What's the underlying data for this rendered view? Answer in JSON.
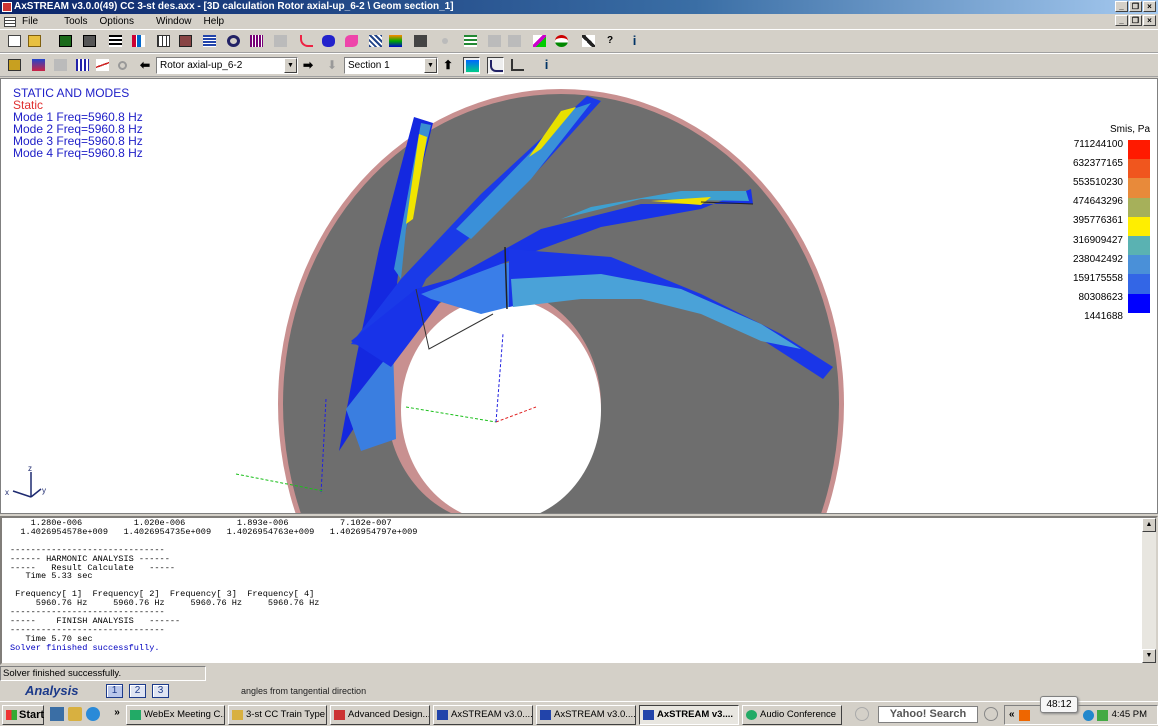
{
  "window": {
    "title": "AxSTREAM  v3.0.0(49)   CC 3-st des.axx - [3D calculation  Rotor axial-up_6-2 \\ Geom section_1]"
  },
  "menu": {
    "items": [
      "File",
      "Tools",
      "Options",
      "Window",
      "Help"
    ]
  },
  "toolbar2": {
    "rotor_select": "Rotor axial-up_6-2",
    "section_select": "Section 1"
  },
  "viewport": {
    "overlay_heading": "STATIC AND MODES",
    "static_label": "Static",
    "modes": [
      "Mode 1 Freq=5960.8 Hz",
      "Mode 2 Freq=5960.8 Hz",
      "Mode 3 Freq=5960.8 Hz",
      "Mode 4 Freq=5960.8 Hz"
    ],
    "axis_labels": {
      "x": "x",
      "y": "y",
      "z": "z"
    },
    "legend": {
      "title": "Smis, Pa",
      "values": [
        "711244100",
        "632377165",
        "553510230",
        "474643296",
        "395776361",
        "316909427",
        "238042492",
        "159175558",
        "80308623",
        "1441688"
      ],
      "colors": [
        "#ff1a00",
        "#f0561e",
        "#e88a3a",
        "#a6b05a",
        "#ffee00",
        "#5ab2b2",
        "#4a90d8",
        "#3366e6",
        "#0000ff"
      ]
    }
  },
  "console": {
    "lines": [
      "    1.280e-006          1.020e-006          1.893e-006          7.102e-007",
      "  1.4026954578e+009   1.4026954735e+009   1.4026954763e+009   1.4026954797e+009",
      "",
      "------------------------------",
      "------ HARMONIC ANALYSIS ------",
      "-----   Result Calculate   -----",
      "   Time 5.33 sec",
      "",
      " Frequency[ 1]  Frequency[ 2]  Frequency[ 3]  Frequency[ 4]",
      "     5960.76 Hz     5960.76 Hz     5960.76 Hz     5960.76 Hz",
      "------------------------------",
      "-----    FINISH ANALYSIS   ------",
      "------------------------------",
      "   Time 5.70 sec"
    ],
    "success_line": "Solver finished successfully."
  },
  "status": {
    "text": "Solver finished successfully.",
    "mode_label": "Analysis",
    "pages": [
      "1",
      "2",
      "3"
    ],
    "hint": "angles from tangential direction"
  },
  "taskbar": {
    "start_label": "Start",
    "tasks": [
      "WebEx Meeting C...",
      "3-st CC Train Type",
      "Advanced Design...",
      "AxSTREAM  v3.0....",
      "AxSTREAM  v3.0....",
      "AxSTREAM  v3....",
      "Audio Conference"
    ],
    "search_label": "Yahoo! Search",
    "clock": "4:45 PM",
    "timer": "48:12"
  }
}
